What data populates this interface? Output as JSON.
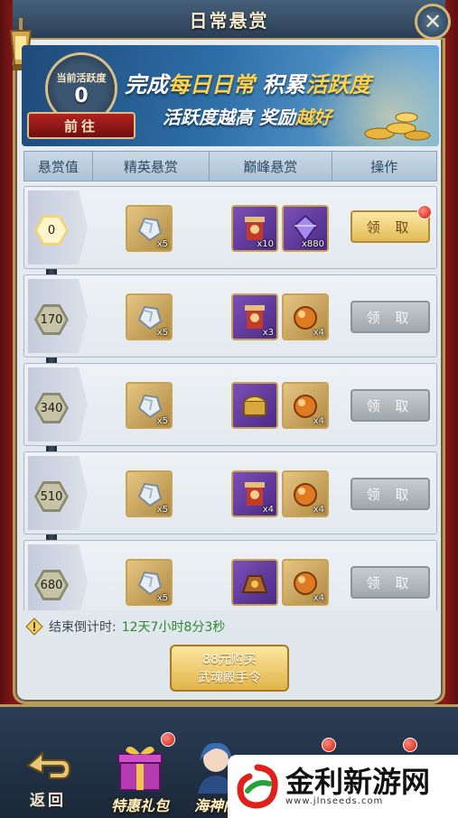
{
  "window": {
    "title": "日常悬赏"
  },
  "banner": {
    "activity_label": "当前活跃度",
    "activity_value": "0",
    "goto_label": "前往",
    "line1_prefix": "完成",
    "line1_hl1": "每日日常",
    "line1_mid": "积累",
    "line1_hl2": "活跃度",
    "line2_prefix": "活跃度越高 奖励",
    "line2_hl": "越好"
  },
  "table": {
    "headers": [
      "悬赏值",
      "精英悬赏",
      "巅峰悬赏",
      "操作"
    ],
    "rows": [
      {
        "threshold": "0",
        "elite": [
          {
            "qty": "x5",
            "icon": "silver-ore-icon"
          }
        ],
        "peak": [
          {
            "qty": "x10",
            "icon": "red-scroll-icon"
          },
          {
            "qty": "x880",
            "icon": "purple-crystal-icon"
          }
        ],
        "action": "领 取",
        "claimable": true
      },
      {
        "threshold": "170",
        "elite": [
          {
            "qty": "x5",
            "icon": "silver-ore-icon"
          }
        ],
        "peak": [
          {
            "qty": "x3",
            "icon": "red-scroll-icon"
          },
          {
            "qty": "x4",
            "icon": "orange-orb-icon"
          }
        ],
        "action": "领 取",
        "claimable": false
      },
      {
        "threshold": "340",
        "elite": [
          {
            "qty": "x5",
            "icon": "silver-ore-icon"
          }
        ],
        "peak": [
          {
            "qty": "",
            "icon": "gold-chest-icon"
          },
          {
            "qty": "x4",
            "icon": "orange-orb-icon"
          }
        ],
        "action": "领 取",
        "claimable": false
      },
      {
        "threshold": "510",
        "elite": [
          {
            "qty": "x5",
            "icon": "silver-ore-icon"
          }
        ],
        "peak": [
          {
            "qty": "x4",
            "icon": "red-scroll-icon"
          },
          {
            "qty": "x4",
            "icon": "orange-orb-icon"
          }
        ],
        "action": "领 取",
        "claimable": false
      },
      {
        "threshold": "680",
        "elite": [
          {
            "qty": "x5",
            "icon": "silver-ore-icon"
          }
        ],
        "peak": [
          {
            "qty": "",
            "icon": "treasure-bag-icon"
          },
          {
            "qty": "x4",
            "icon": "orange-orb-icon"
          }
        ],
        "action": "领 取",
        "claimable": false
      }
    ]
  },
  "countdown": {
    "label": "结束倒计时:",
    "value": "12天7小时8分3秒"
  },
  "buy": {
    "line1": "88元购买",
    "line2": "武魂殿手令"
  },
  "bottom": {
    "back_label": "返回",
    "items": [
      "特惠礼包",
      "海神阁"
    ]
  },
  "watermark": {
    "title": "金利新游网",
    "url": "www.jlnseeds.com"
  },
  "colors": {
    "accent_gold": "#d9c08a",
    "claim_green": "#2c8a2c",
    "banner_blue": "#2d6da6"
  }
}
